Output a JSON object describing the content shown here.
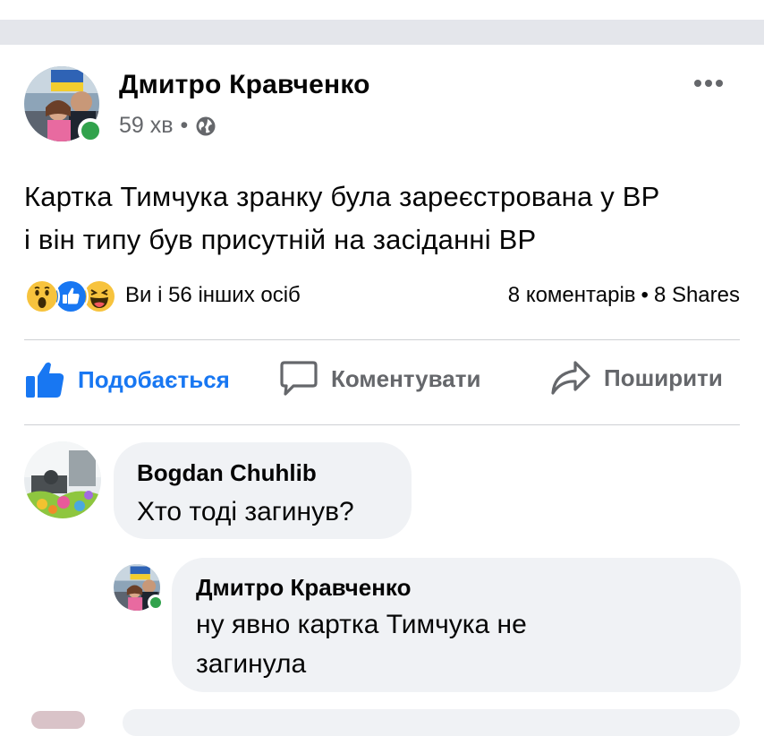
{
  "post": {
    "author": "Дмитро Кравченко",
    "time": "59 хв",
    "separator": "•",
    "text_lines": [
      "Картка Тимчука зранку була зареєстрована у ВР",
      "і він типу був присутній на засіданні ВР"
    ],
    "reactions_label": "Ви і 56 інших осіб",
    "comments_count": "8 коментарів",
    "shares_count": "8 Shares",
    "reaction_icons": [
      "wow-icon",
      "like-icon",
      "haha-icon"
    ]
  },
  "actions": {
    "like": "Подобається",
    "comment": "Коментувати",
    "share": "Поширити"
  },
  "comments": [
    {
      "author": "Bogdan  Chuhlib",
      "text_lines": [
        "Хто тоді загинув?"
      ]
    },
    {
      "author": "Дмитро Кравченко",
      "text_lines": [
        "ну явно картка Тимчука не",
        "загинула"
      ]
    }
  ],
  "colors": {
    "accent": "#1877f2",
    "secondary_text": "#65676b",
    "bubble": "#f0f2f5",
    "online": "#31a24c",
    "band": "#e4e6eb"
  }
}
